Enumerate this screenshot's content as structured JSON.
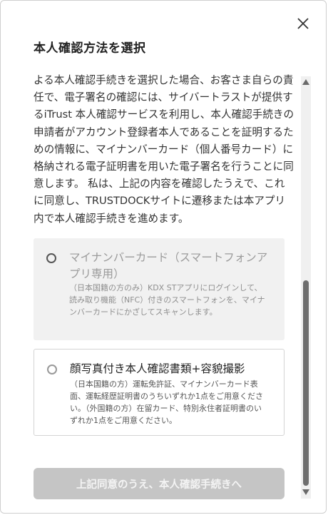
{
  "dialog": {
    "title": "本人確認方法を選択",
    "close_icon": "close-icon"
  },
  "consent_text": "よる本人確認手続きを選択した場合、お客さま自らの責任で、電子署名の確認には、サイバートラストが提供するiTrust 本人確認サービスを利用し、本人確認手続きの申請者がアカウント登録者本人であることを証明するための情報に、マイナンバーカード（個人番号カード）に格納される電子証明書を用いた電子署名を行うことに同意します。 私は、上記の内容を確認したうえで、これに同意し、TRUSTDOCKサイトに遷移または本アプリ内で本人確認手続きを進めます。",
  "options": [
    {
      "title": "マイナンバーカード（スマートフォンアプリ専用）",
      "description": "（日本国籍の方のみ）KDX STアプリにログインして、読み取り機能（NFC）付きのスマートフォンを、マイナンバーカードにかざしてスキャンします。",
      "state": "disabled"
    },
    {
      "title": "顔写真付き本人確認書類+容貌撮影",
      "description": "（日本国籍の方）運転免許証、マイナンバーカード表面、運転経歴証明書のうちいずれか1点をご用意ください。（外国籍の方）在留カード、特別永住者証明書のいずれか1点をご用意ください。",
      "state": "enabled"
    }
  ],
  "primary_button": {
    "label": "上記同意のうえ、本人確認手続きへ",
    "state": "disabled"
  },
  "colors": {
    "disabled_button_bg": "#c5c5c5",
    "disabled_option_bg": "#f1f1f1",
    "text": "#333333"
  }
}
